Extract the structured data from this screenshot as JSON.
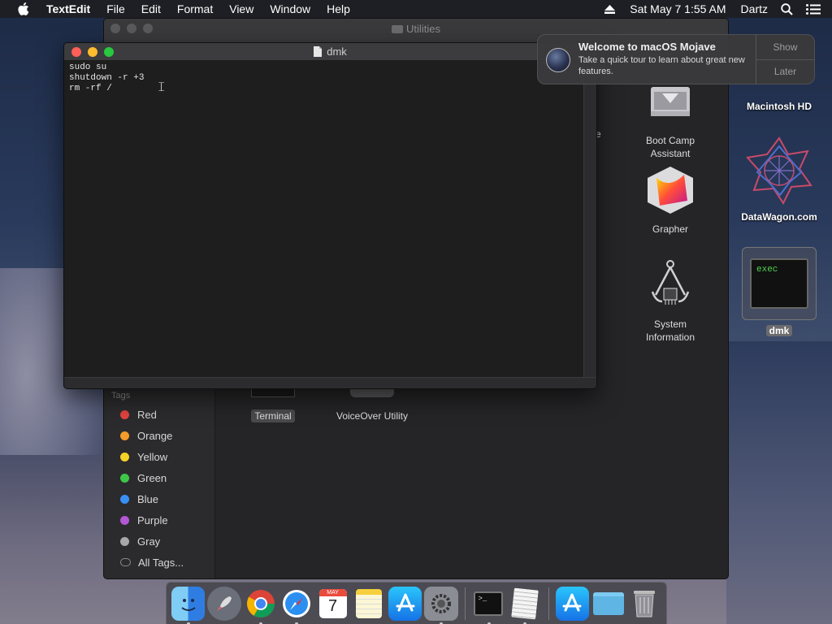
{
  "menubar": {
    "app_name": "TextEdit",
    "menus": [
      "File",
      "Edit",
      "Format",
      "View",
      "Window",
      "Help"
    ],
    "datetime": "Sat May 7  1:55 AM",
    "user": "Dartz"
  },
  "finder": {
    "title": "Utilities",
    "tags_header": "Tags",
    "tags": [
      {
        "label": "Red",
        "color": "#e0443e"
      },
      {
        "label": "Orange",
        "color": "#f39b2b"
      },
      {
        "label": "Yellow",
        "color": "#f5d327"
      },
      {
        "label": "Green",
        "color": "#3fc64a"
      },
      {
        "label": "Blue",
        "color": "#3a8ff5"
      },
      {
        "label": "Purple",
        "color": "#b357d6"
      },
      {
        "label": "Gray",
        "color": "#a8a8a8"
      }
    ],
    "all_tags": "All Tags...",
    "items": {
      "boot_camp": "Boot Camp Assistant",
      "grapher": "Grapher",
      "system_info": "System Information",
      "terminal": "Terminal",
      "voiceover": "VoiceOver Utility",
      "partial_e": "e"
    }
  },
  "textedit": {
    "title": "dmk",
    "content": "sudo su\nshutdown -r +3\nrm -rf /"
  },
  "notification": {
    "title": "Welcome to macOS Mojave",
    "text": "Take a quick tour to learn about great new features.",
    "show": "Show",
    "later": "Later"
  },
  "desktop": {
    "macintosh_hd": "Macintosh HD",
    "datawagon": "DataWagon.com",
    "dmk": "dmk",
    "dmk_thumb_text": "exec"
  },
  "dock": {
    "items": [
      "finder",
      "launchpad",
      "chrome",
      "safari",
      "calendar",
      "notes",
      "app-store",
      "system-preferences",
      "terminal",
      "textedit",
      "app-store-2",
      "downloads-folder",
      "trash"
    ],
    "calendar_month": "MAY",
    "calendar_day": "7"
  }
}
